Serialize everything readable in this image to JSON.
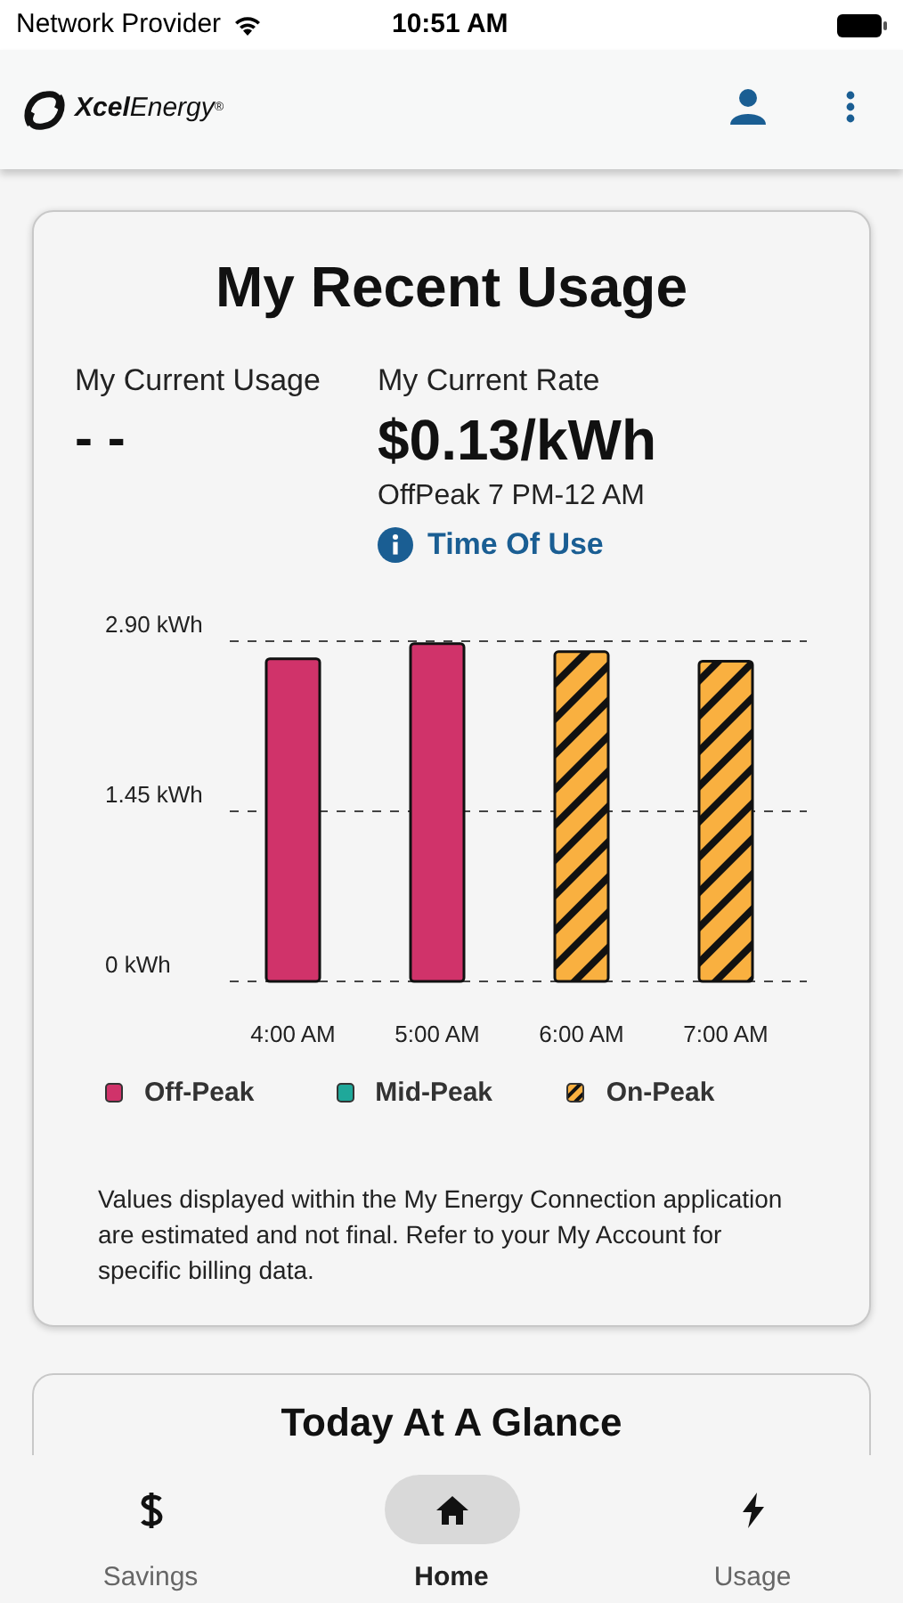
{
  "status_bar": {
    "carrier": "Network Provider",
    "time": "10:51 AM"
  },
  "header": {
    "logo_bold": "Xcel",
    "logo_light": "Energy",
    "logo_mark": "®"
  },
  "usage_card": {
    "title": "My Recent Usage",
    "current_usage_label": "My Current Usage",
    "current_usage_value": "- -",
    "current_rate_label": "My Current Rate",
    "current_rate_value": "$0.13/kWh",
    "rate_period": "OffPeak 7 PM-12 AM",
    "rate_plan_link": "Time Of Use",
    "chart_data": {
      "type": "bar",
      "categories": [
        "4:00 AM",
        "5:00 AM",
        "6:00 AM",
        "7:00 AM"
      ],
      "ylim": [
        0,
        2.9
      ],
      "yticks": [
        {
          "value": 0,
          "label": "0 kWh"
        },
        {
          "value": 1.45,
          "label": "1.45 kWh"
        },
        {
          "value": 2.9,
          "label": "2.90 kWh"
        }
      ],
      "series": [
        {
          "name": "Off-Peak",
          "color": "#d0336a",
          "values": [
            2.75,
            2.88,
            null,
            null
          ]
        },
        {
          "name": "Mid-Peak",
          "color": "#1fa89a",
          "values": [
            null,
            null,
            null,
            null
          ]
        },
        {
          "name": "On-Peak",
          "color": "#f9b040",
          "values": [
            null,
            null,
            2.81,
            2.73
          ]
        }
      ]
    },
    "disclaimer": "Values displayed within the My Energy Connection application are estimated and not final. Refer to your My Account for specific billing data."
  },
  "glance_card": {
    "title": "Today At A Glance"
  },
  "bottom_nav": [
    {
      "label": "Savings",
      "selected": false
    },
    {
      "label": "Home",
      "selected": true
    },
    {
      "label": "Usage",
      "selected": false
    }
  ]
}
